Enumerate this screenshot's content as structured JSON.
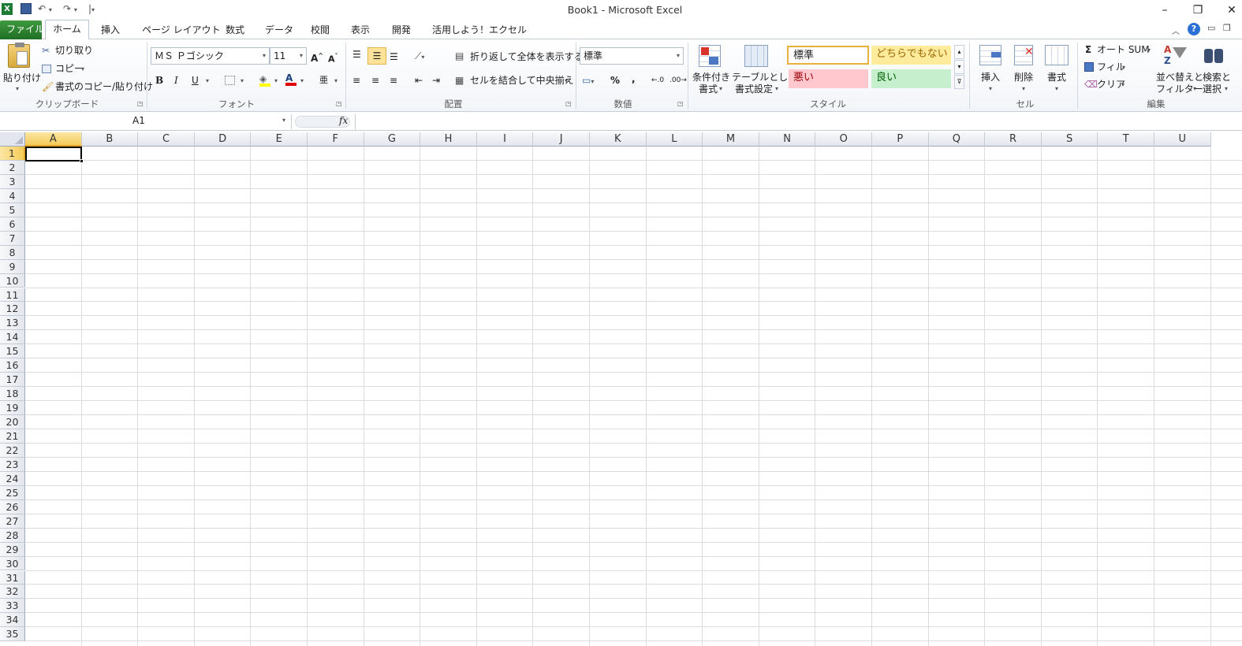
{
  "window": {
    "title": "Book1  -  Microsoft Excel",
    "minimize": "–",
    "restore": "❐",
    "close": "✕"
  },
  "tabs": [
    "ファイル",
    "ホーム",
    "挿入",
    "ページ レイアウト",
    "数式",
    "データ",
    "校閲",
    "表示",
    "開発",
    "活用しよう！エクセル"
  ],
  "ribbon": {
    "clipboard": {
      "paste": "貼り付け",
      "cut": "切り取り",
      "copy": "コピー",
      "format_painter": "書式のコピー/貼り付け",
      "label": "クリップボード"
    },
    "font": {
      "name": "ＭＳ Ｐゴシック",
      "size": "11",
      "label": "フォント",
      "bold": "B",
      "italic": "I",
      "underline": "U"
    },
    "alignment": {
      "wrap": "折り返して全体を表示する",
      "merge": "セルを結合して中央揃え",
      "label": "配置"
    },
    "number": {
      "format": "標準",
      "percent": "%",
      "comma": ",",
      "label": "数値"
    },
    "styles": {
      "conditional": "条件付き",
      "conditional2": "書式",
      "table": "テーブルとして",
      "table2": "書式設定",
      "normal": "標準",
      "neutral": "どちらでもない",
      "bad": "悪い",
      "good": "良い",
      "label": "スタイル"
    },
    "cells": {
      "insert": "挿入",
      "delete": "削除",
      "format": "書式",
      "label": "セル"
    },
    "editing": {
      "autosum": "オート SUM",
      "fill": "フィル",
      "clear": "クリア",
      "sort": "並べ替えと",
      "sort2": "フィルター",
      "find": "検索と",
      "find2": "選択",
      "label": "編集"
    }
  },
  "formula_bar": {
    "name_box": "A1",
    "fx": "fx",
    "value": ""
  },
  "columns": [
    "A",
    "B",
    "C",
    "D",
    "E",
    "F",
    "G",
    "H",
    "I",
    "J",
    "K",
    "L",
    "M",
    "N",
    "O",
    "P",
    "Q",
    "R",
    "S",
    "T",
    "U"
  ],
  "rows": [
    "1",
    "2",
    "3",
    "4",
    "5",
    "6",
    "7",
    "8",
    "9",
    "10",
    "11",
    "12",
    "13",
    "14",
    "15",
    "16",
    "17",
    "18",
    "19",
    "20",
    "21",
    "22",
    "23",
    "24",
    "25",
    "26",
    "27",
    "28",
    "29",
    "30",
    "31",
    "32",
    "33",
    "34",
    "35"
  ],
  "colors": {
    "file_tab": "#2e7d32",
    "selected_header": "#f9d97a",
    "style_neutral_bg": "#ffeb9c",
    "style_bad_bg": "#ffc7ce",
    "style_good_bg": "#c6efce"
  }
}
